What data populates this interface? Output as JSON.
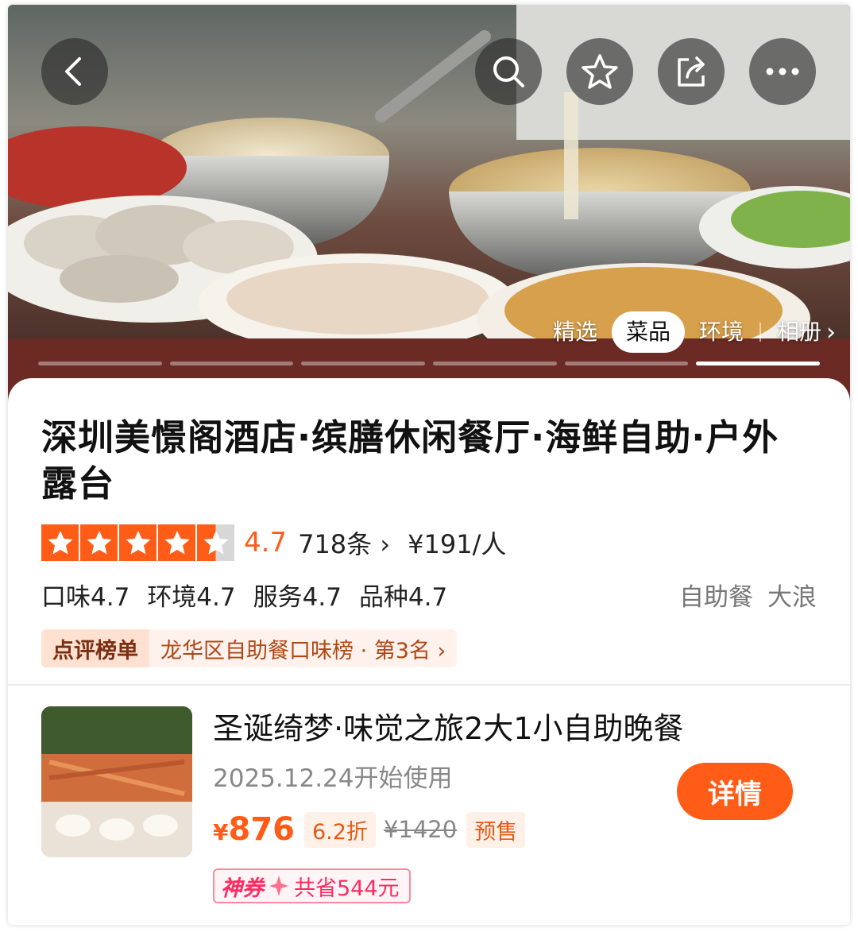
{
  "header": {
    "back_icon": "chevron-left-icon",
    "actions": [
      "search-icon",
      "star-icon",
      "share-icon",
      "more-icon"
    ]
  },
  "gallery": {
    "tabs": [
      "精选",
      "菜品",
      "环境",
      "相册"
    ],
    "active_tab": "菜品",
    "more_icon": "chevron-right-icon",
    "progress": {
      "total": 6,
      "current": 6
    }
  },
  "restaurant": {
    "name": "深圳美憬阁酒店·缤膳休闲餐厅·海鲜自助·户外露台",
    "rating": {
      "stars": 4.5,
      "score": "4.7",
      "reviews": "718条",
      "review_chevron": "›",
      "price_per_person": "¥191/人"
    },
    "subscores": [
      "口味4.7",
      "环境4.7",
      "服务4.7",
      "品种4.7"
    ],
    "categories": [
      "自助餐",
      "大浪"
    ],
    "ranking": {
      "badge": "点评榜单",
      "text": "龙华区自助餐口味榜 · 第3名 ›"
    }
  },
  "deal": {
    "title": "圣诞绮梦·味觉之旅2大1小自助晚餐",
    "date": "2025.12.24开始使用",
    "price_symbol": "¥",
    "price": "876",
    "discount": "6.2折",
    "original_price": "¥1420",
    "presale": "预售",
    "coupon_badge": "神券",
    "coupon_text": "共省544元",
    "detail_button": "详情"
  },
  "colors": {
    "accent": "#ff5c17",
    "coupon": "#ff2a62"
  }
}
